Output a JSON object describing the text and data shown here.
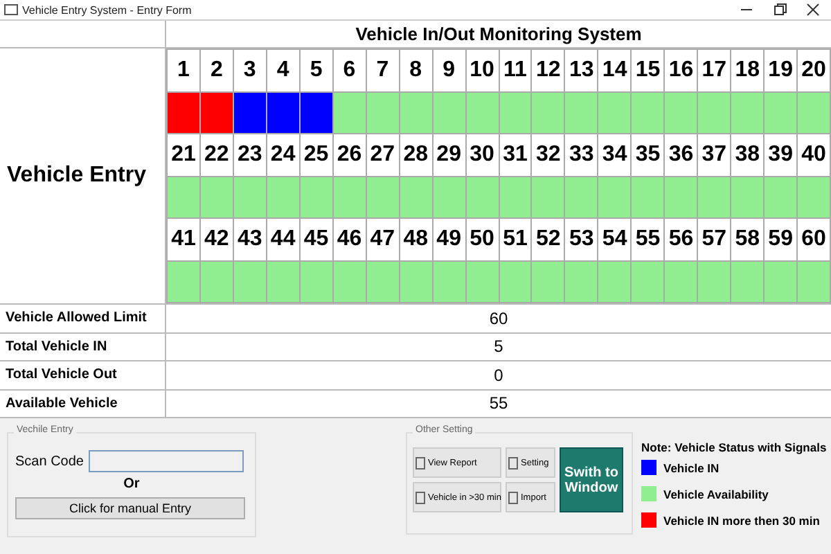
{
  "window": {
    "title": "Vehicle Entry System - Entry Form"
  },
  "monitor": {
    "title": "Vehicle In/Out Monitoring System",
    "side_label": "Vehicle Entry",
    "slots": [
      {
        "number": "1",
        "color": "#ff0000"
      },
      {
        "number": "2",
        "color": "#ff0000"
      },
      {
        "number": "3",
        "color": "#0000ff"
      },
      {
        "number": "4",
        "color": "#0000ff"
      },
      {
        "number": "5",
        "color": "#0000ff"
      },
      {
        "number": "6",
        "color": "#90ee90"
      },
      {
        "number": "7",
        "color": "#90ee90"
      },
      {
        "number": "8",
        "color": "#90ee90"
      },
      {
        "number": "9",
        "color": "#90ee90"
      },
      {
        "number": "10",
        "color": "#90ee90"
      },
      {
        "number": "11",
        "color": "#90ee90"
      },
      {
        "number": "12",
        "color": "#90ee90"
      },
      {
        "number": "13",
        "color": "#90ee90"
      },
      {
        "number": "14",
        "color": "#90ee90"
      },
      {
        "number": "15",
        "color": "#90ee90"
      },
      {
        "number": "16",
        "color": "#90ee90"
      },
      {
        "number": "17",
        "color": "#90ee90"
      },
      {
        "number": "18",
        "color": "#90ee90"
      },
      {
        "number": "19",
        "color": "#90ee90"
      },
      {
        "number": "20",
        "color": "#90ee90"
      },
      {
        "number": "21",
        "color": "#90ee90"
      },
      {
        "number": "22",
        "color": "#90ee90"
      },
      {
        "number": "23",
        "color": "#90ee90"
      },
      {
        "number": "24",
        "color": "#90ee90"
      },
      {
        "number": "25",
        "color": "#90ee90"
      },
      {
        "number": "26",
        "color": "#90ee90"
      },
      {
        "number": "27",
        "color": "#90ee90"
      },
      {
        "number": "28",
        "color": "#90ee90"
      },
      {
        "number": "29",
        "color": "#90ee90"
      },
      {
        "number": "30",
        "color": "#90ee90"
      },
      {
        "number": "31",
        "color": "#90ee90"
      },
      {
        "number": "32",
        "color": "#90ee90"
      },
      {
        "number": "33",
        "color": "#90ee90"
      },
      {
        "number": "34",
        "color": "#90ee90"
      },
      {
        "number": "35",
        "color": "#90ee90"
      },
      {
        "number": "36",
        "color": "#90ee90"
      },
      {
        "number": "37",
        "color": "#90ee90"
      },
      {
        "number": "38",
        "color": "#90ee90"
      },
      {
        "number": "39",
        "color": "#90ee90"
      },
      {
        "number": "40",
        "color": "#90ee90"
      },
      {
        "number": "41",
        "color": "#90ee90"
      },
      {
        "number": "42",
        "color": "#90ee90"
      },
      {
        "number": "43",
        "color": "#90ee90"
      },
      {
        "number": "44",
        "color": "#90ee90"
      },
      {
        "number": "45",
        "color": "#90ee90"
      },
      {
        "number": "46",
        "color": "#90ee90"
      },
      {
        "number": "47",
        "color": "#90ee90"
      },
      {
        "number": "48",
        "color": "#90ee90"
      },
      {
        "number": "49",
        "color": "#90ee90"
      },
      {
        "number": "50",
        "color": "#90ee90"
      },
      {
        "number": "51",
        "color": "#90ee90"
      },
      {
        "number": "52",
        "color": "#90ee90"
      },
      {
        "number": "53",
        "color": "#90ee90"
      },
      {
        "number": "54",
        "color": "#90ee90"
      },
      {
        "number": "55",
        "color": "#90ee90"
      },
      {
        "number": "56",
        "color": "#90ee90"
      },
      {
        "number": "57",
        "color": "#90ee90"
      },
      {
        "number": "58",
        "color": "#90ee90"
      },
      {
        "number": "59",
        "color": "#90ee90"
      },
      {
        "number": "60",
        "color": "#90ee90"
      }
    ]
  },
  "summary": [
    {
      "label": "Vehicle Allowed Limit",
      "value": "60"
    },
    {
      "label": "Total Vehicle IN",
      "value": "5"
    },
    {
      "label": "Total Vehicle Out",
      "value": "0"
    },
    {
      "label": "Available Vehicle",
      "value": "55"
    }
  ],
  "entry_group": {
    "title": "Vechile Entry",
    "scan_label": "Scan Code",
    "separator": "Or",
    "manual_button": "Click for manual Entry"
  },
  "settings_group": {
    "title": "Other Setting",
    "buttons": [
      {
        "kind": "small",
        "label": "View Report"
      },
      {
        "kind": "small",
        "label": "Setting"
      },
      {
        "kind": "big",
        "label": "Swith to Window"
      },
      {
        "kind": "small",
        "label": "Vehicle in >30 min"
      },
      {
        "kind": "small",
        "label": "Import"
      }
    ]
  },
  "legend": {
    "title": "Note: Vehicle Status with Signals",
    "items": [
      {
        "label": "Vehicle IN",
        "color": "#0000ff"
      },
      {
        "label": "Vehicle Availability",
        "color": "#90ee90"
      },
      {
        "label": "Vehicle IN more then 30 min",
        "color": "#ff0000"
      }
    ]
  }
}
